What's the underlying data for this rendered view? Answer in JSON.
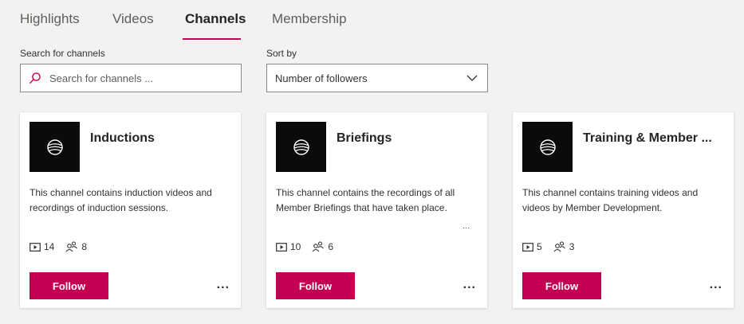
{
  "tabs": [
    {
      "label": "Highlights"
    },
    {
      "label": "Videos"
    },
    {
      "label": "Channels"
    },
    {
      "label": "Membership"
    }
  ],
  "active_tab": "Channels",
  "search": {
    "label": "Search for channels",
    "placeholder": "Search for channels ..."
  },
  "sort": {
    "label": "Sort by",
    "value": "Number of followers"
  },
  "cards": [
    {
      "title": "Inductions",
      "description": "This channel contains induction videos and recordings of induction sessions.",
      "videos": "14",
      "followers": "8",
      "follow_label": "Follow",
      "more_label": "..."
    },
    {
      "title": "Briefings",
      "description": "This channel contains the recordings of all Member Briefings that have taken place.",
      "truncation": "...",
      "videos": "10",
      "followers": "6",
      "follow_label": "Follow",
      "more_label": "..."
    },
    {
      "title": "Training & Member ...",
      "description": "This channel contains training videos and videos by Member Development.",
      "videos": "5",
      "followers": "3",
      "follow_label": "Follow",
      "more_label": "..."
    }
  ],
  "colors": {
    "accent": "#c30052",
    "background": "#f3f2f1",
    "card": "#ffffff"
  }
}
